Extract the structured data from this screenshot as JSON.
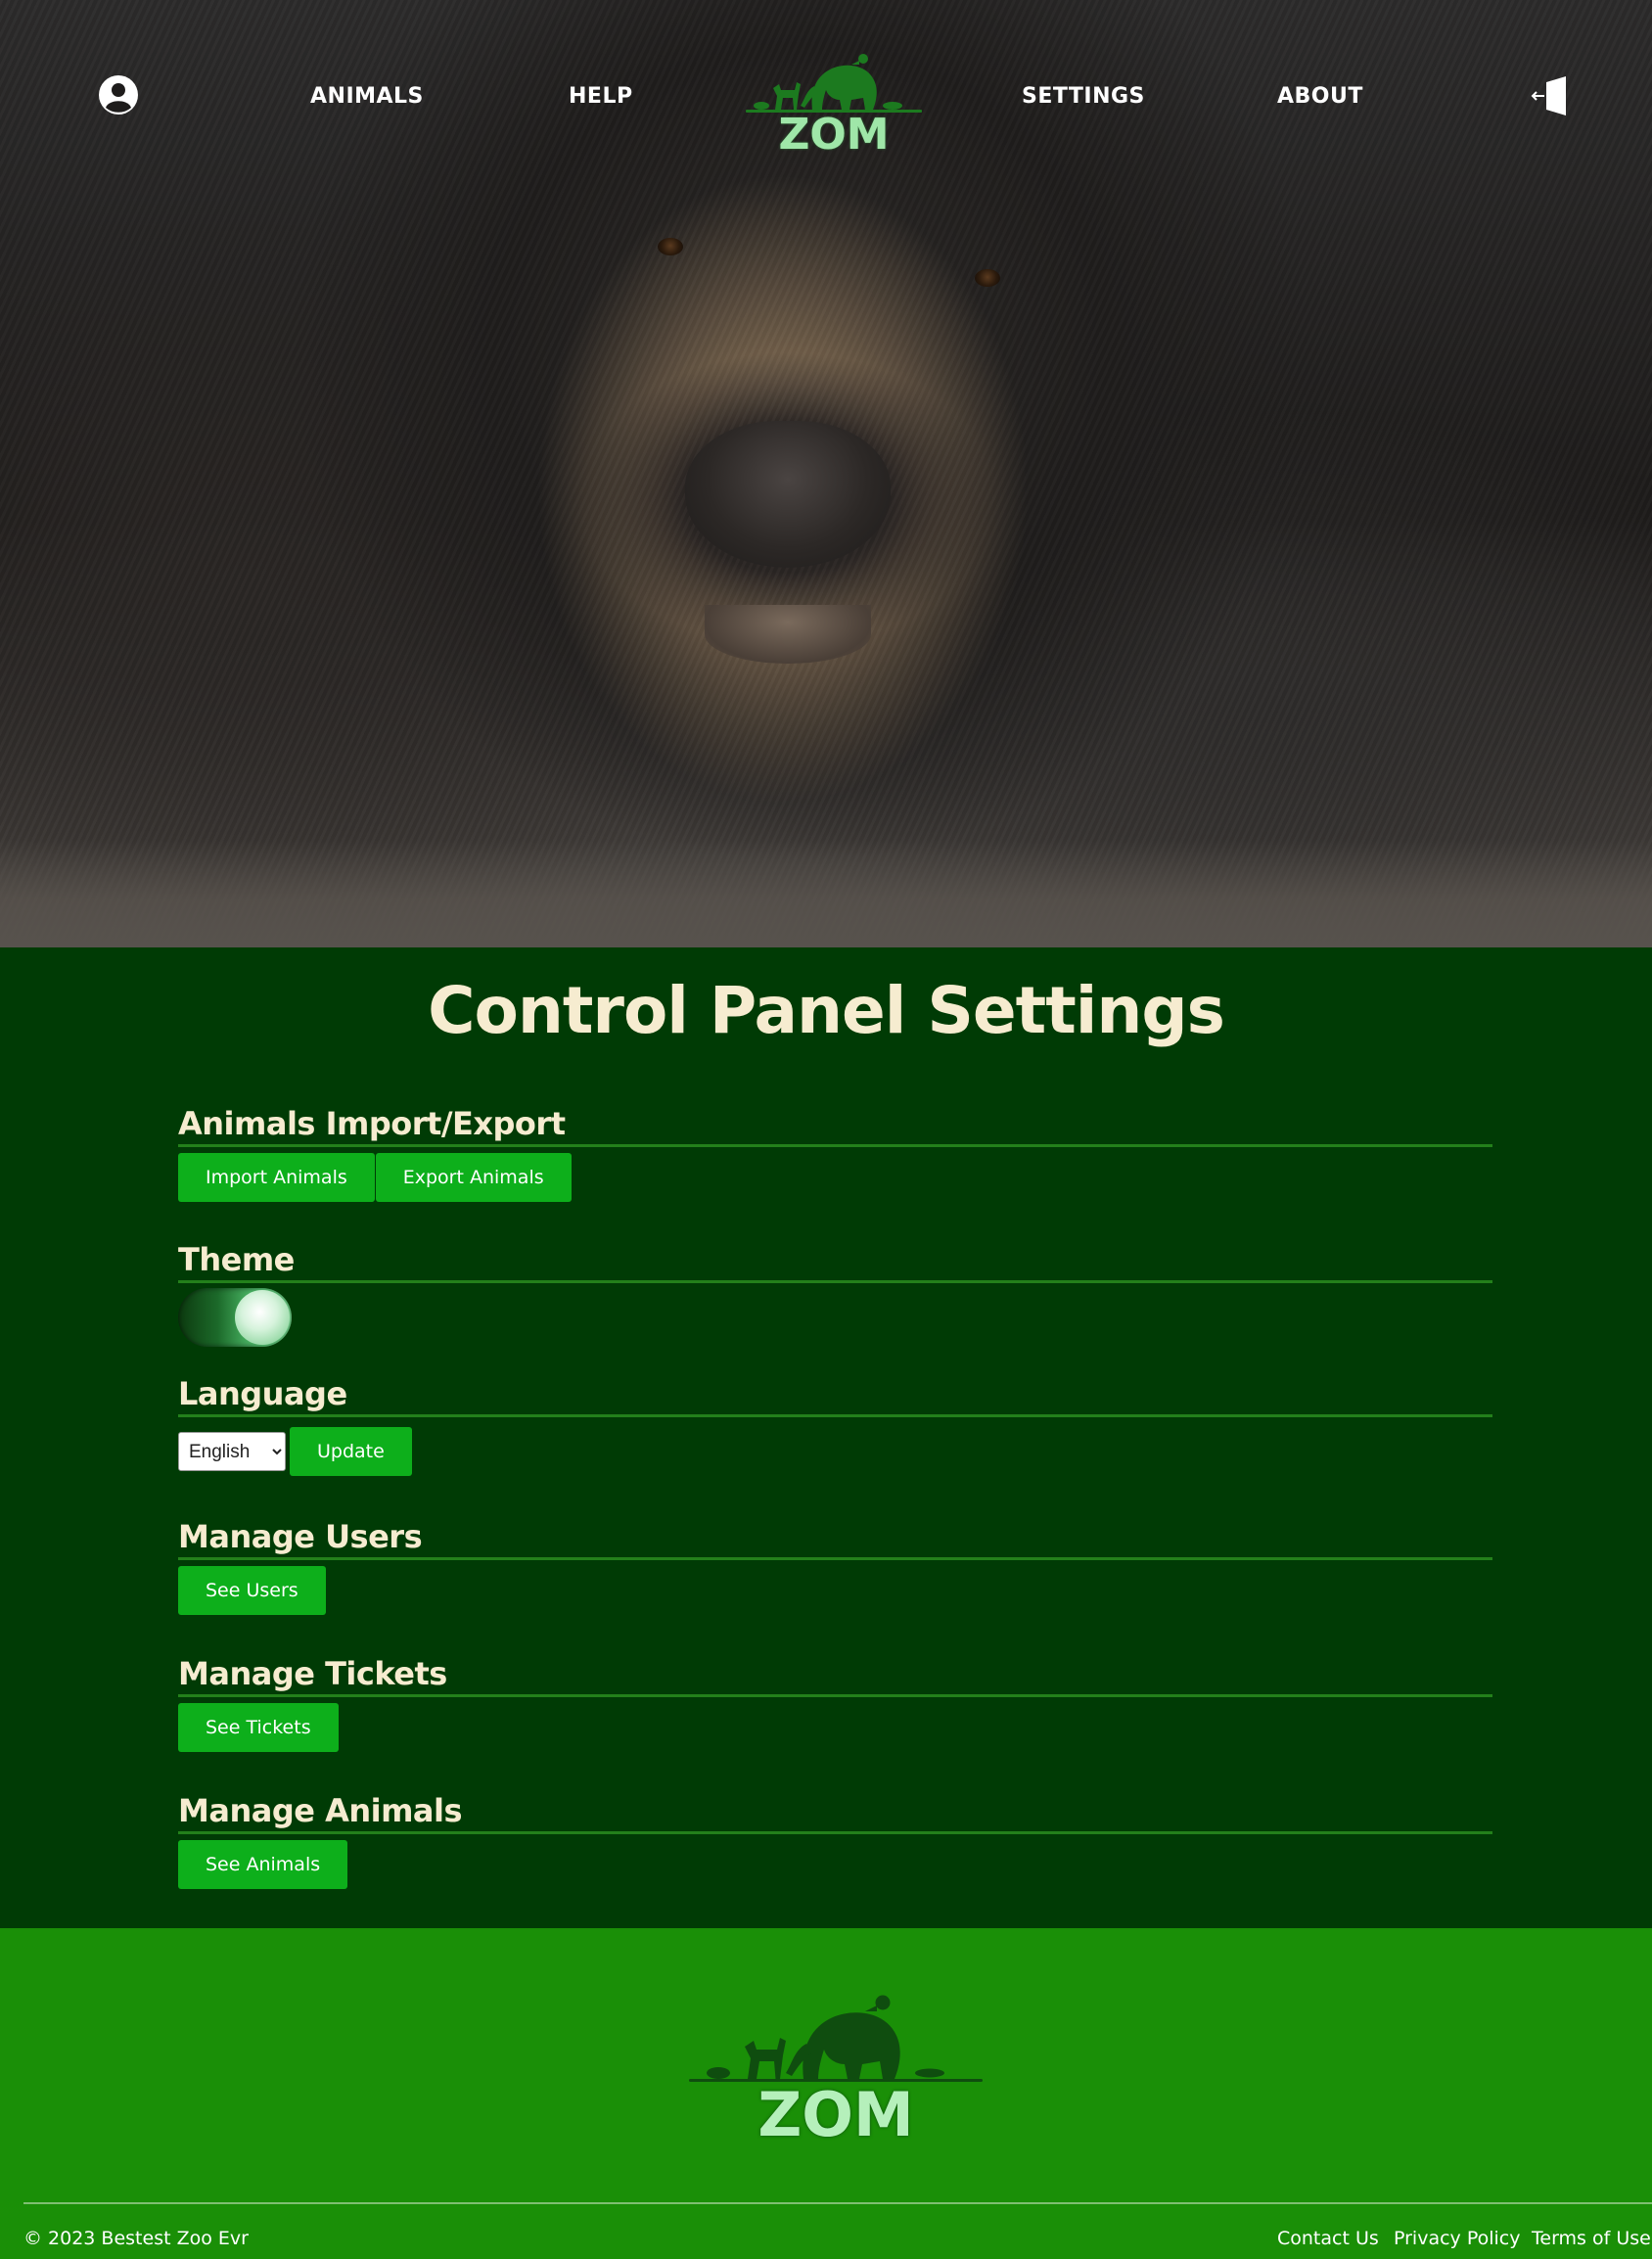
{
  "nav": {
    "links": [
      "ANIMALS",
      "HELP",
      "SETTINGS",
      "ABOUT"
    ],
    "logo_text": "ZOM",
    "user_icon": "user-circle-icon",
    "logout_icon": "logout-door-icon"
  },
  "hero": {
    "image": "black bear close-up photo"
  },
  "main": {
    "title": "Control Panel Settings",
    "sections": [
      {
        "heading": "Animals Import/Export",
        "buttons": [
          "Import Animals",
          "Export Animals"
        ]
      },
      {
        "heading": "Theme",
        "toggle_on": true
      },
      {
        "heading": "Language",
        "selected_language": "English",
        "button": "Update"
      },
      {
        "heading": "Manage Users",
        "button": "See Users"
      },
      {
        "heading": "Manage Tickets",
        "button": "See Tickets"
      },
      {
        "heading": "Manage Animals",
        "button": "See Animals"
      }
    ]
  },
  "footer": {
    "logo_text": "ZOM",
    "copyright": "© 2023 Bestest Zoo Evr",
    "links": [
      "Contact Us",
      "Privacy Policy",
      "Terms of Use"
    ]
  },
  "colors": {
    "main_bg": "#003b05",
    "button": "#0daf1b",
    "heading": "#f6ecd0",
    "footer_bg": "#1a8f07",
    "logo_green": "#1c7a1f"
  }
}
